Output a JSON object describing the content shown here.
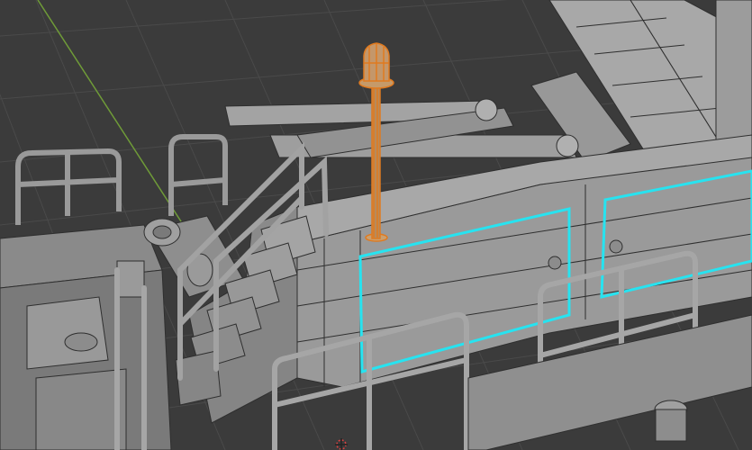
{
  "viewport": {
    "mode": "3D Viewport",
    "selected_object": "antenna mast"
  },
  "colors": {
    "background": "#3b3b3b",
    "grid_line": "#4a4a4a",
    "axis_y": "#6f9b38",
    "model_gray": "#8e8e8e",
    "model_light": "#a8a8a8",
    "model_dark": "#6c6c6c",
    "wire": "#2f2f2f",
    "selection_orange": "#e07a1f",
    "selection_cyan": "#27e3f0"
  },
  "icons": {
    "cursor": "3d-cursor-icon"
  }
}
